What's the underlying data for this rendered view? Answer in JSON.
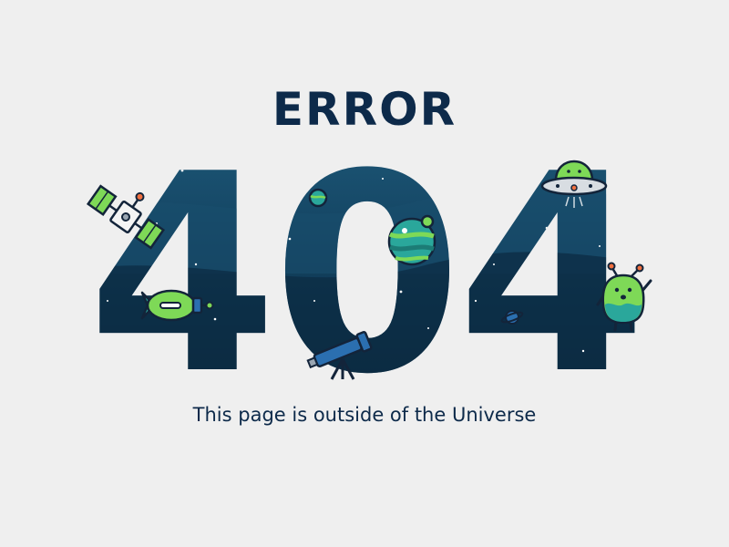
{
  "error": {
    "label": "ERROR",
    "code": "404",
    "message": "This page is outside of the Universe"
  },
  "icons": [
    "satellite-icon",
    "rocket-icon",
    "planet-icon",
    "ufo-icon",
    "alien-icon",
    "telescope-icon",
    "ringed-planet-icon"
  ],
  "colors": {
    "background": "#efefef",
    "text": "#0d2a4a",
    "space_dark": "#0b2a40",
    "space_light": "#1e5a7a",
    "alien_green": "#7ed957",
    "planet_teal": "#2aa79b"
  }
}
